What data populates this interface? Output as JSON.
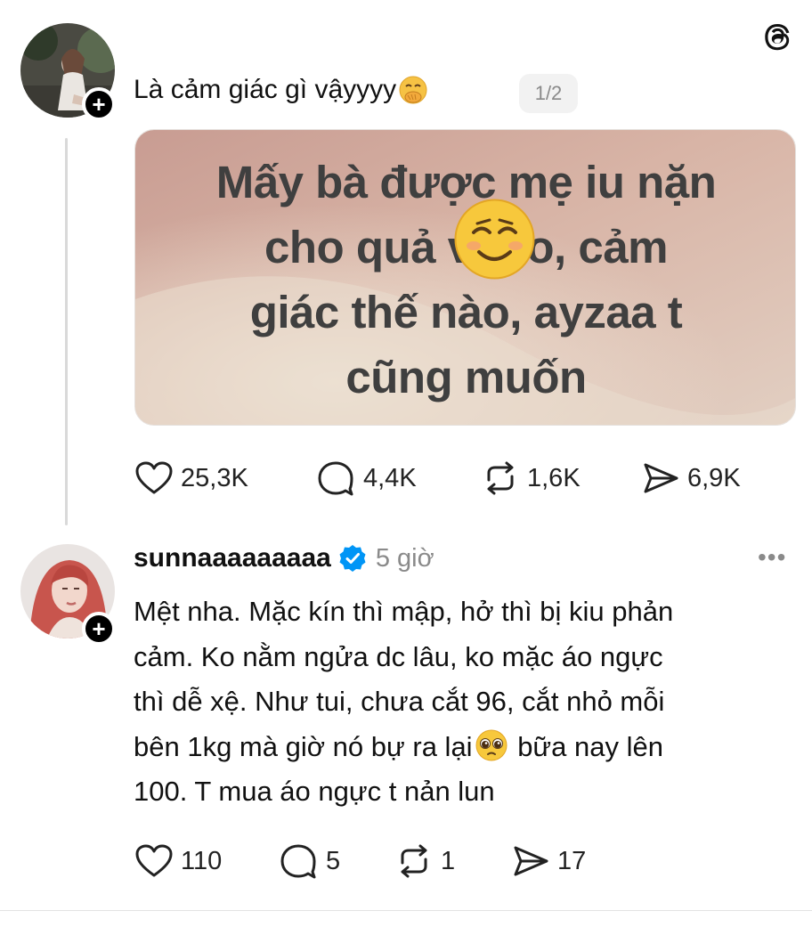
{
  "post": {
    "text": "Là cảm giác gì vậyyyy",
    "text_emoji": "hand-over-mouth-emoji",
    "page_indicator": "1/2",
    "image_text": [
      "Mấy bà được mẹ iu nặn",
      "cho quả vú to, cảm",
      "giác thế nào, ayzaa t",
      "cũng muốn"
    ],
    "image_emoji": "smiling-face-emoji",
    "stats": {
      "likes": "25,3K",
      "replies": "4,4K",
      "reposts": "1,6K",
      "shares": "6,9K"
    }
  },
  "reply": {
    "username": "sunnaaaaaaaaa",
    "verified": true,
    "time": "5 giờ",
    "lines": [
      "Mệt nha. Mặc kín thì mập, hở thì bị kiu phản",
      "cảm. Ko nằm ngửa dc lâu, ko mặc áo ngực",
      "thì dễ xệ. Như tui, chưa cắt 96, cắt nhỏ mỗi",
      "bên 1kg mà giờ nó bự ra lại",
      " bữa nay lên",
      "100. T mua áo ngực t nản lun"
    ],
    "inline_emoji": "pleading-face-emoji",
    "stats": {
      "likes": "110",
      "replies": "5",
      "reposts": "1",
      "shares": "17"
    }
  },
  "colors": {
    "accent": "#111111",
    "muted": "#8a8a8a",
    "verified": "#0095f6",
    "thread_line": "#d9d9d9"
  }
}
